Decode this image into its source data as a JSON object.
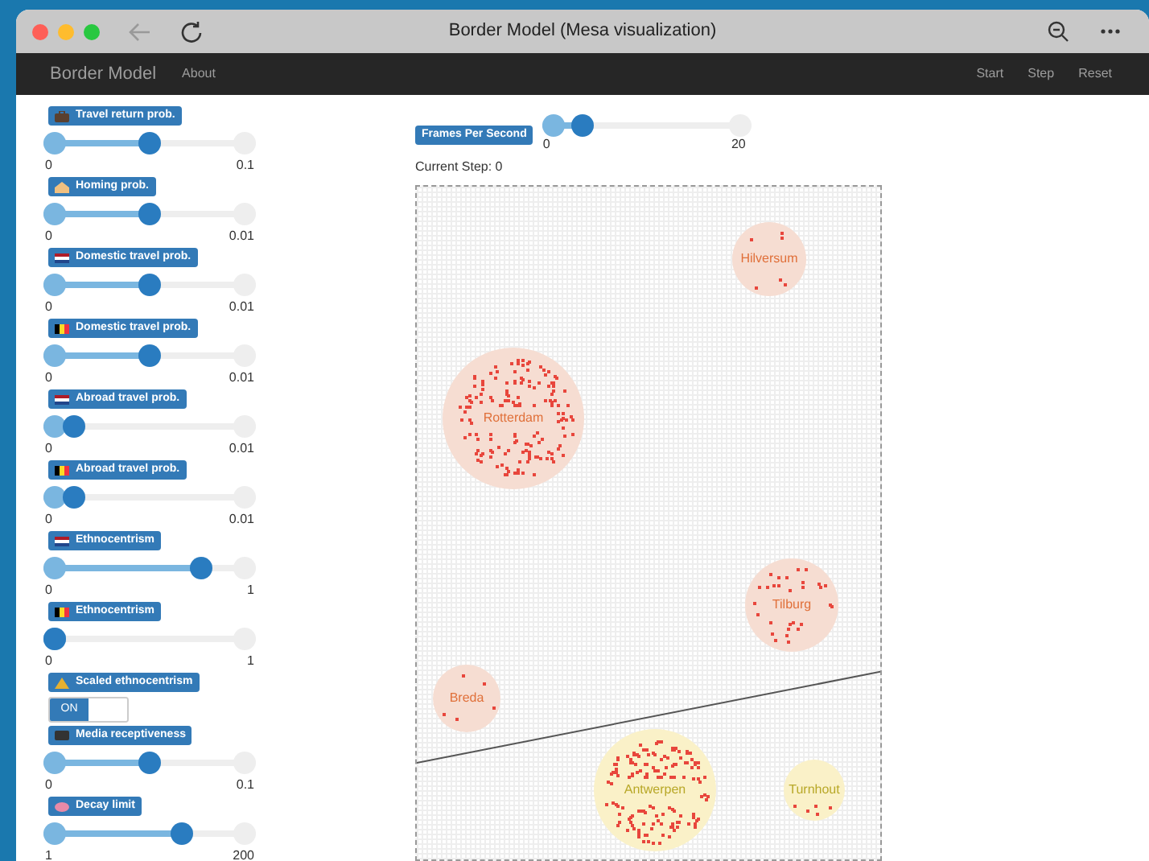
{
  "window": {
    "title": "Border Model (Mesa visualization)"
  },
  "navbar": {
    "brand": "Border Model",
    "links": [
      "About"
    ],
    "actions": [
      "Start",
      "Step",
      "Reset"
    ]
  },
  "params": [
    {
      "kind": "slider",
      "label": "Travel return prob.",
      "level": 0.5,
      "min": "0",
      "max": "0.1"
    },
    {
      "kind": "slider",
      "label": "Homing prob.",
      "level": 0.5,
      "min": "0",
      "max": "0.01"
    },
    {
      "kind": "slider",
      "label": "Domestic travel prob.",
      "level": 0.5,
      "min": "0",
      "max": "0.01"
    },
    {
      "kind": "slider",
      "label": "Domestic travel prob.",
      "level": 0.5,
      "min": "0",
      "max": "0.01"
    },
    {
      "kind": "slider",
      "label": "Abroad travel prob.",
      "level": 0.1,
      "min": "0",
      "max": "0.01"
    },
    {
      "kind": "slider",
      "label": "Abroad travel prob.",
      "level": 0.1,
      "min": "0",
      "max": "0.01"
    },
    {
      "kind": "slider",
      "label": "Ethnocentrism",
      "level": 0.77,
      "min": "0",
      "max": "1"
    },
    {
      "kind": "slider",
      "label": "Ethnocentrism",
      "level": 0,
      "min": "0",
      "max": "1"
    },
    {
      "kind": "switch",
      "label": "Scaled ethnocentrism",
      "on": true,
      "state_text": "ON"
    },
    {
      "kind": "slider",
      "label": "Media receptiveness",
      "level": 0.5,
      "min": "0",
      "max": "0.1"
    },
    {
      "kind": "slider",
      "label": "Decay limit",
      "level": 0.67,
      "min": "1",
      "max": "200"
    }
  ],
  "fps": {
    "label": "Frames Per Second",
    "level": 0.15,
    "min": "0",
    "max": "20"
  },
  "step": "Current Step: 0",
  "cities": [
    {
      "name": "Hilversum",
      "color": "#f6ddd2"
    },
    {
      "name": "Rotterdam",
      "color": "#f6ddd2"
    },
    {
      "name": "Tilburg",
      "color": "#f6ddd2"
    },
    {
      "name": "Breda",
      "color": "#f6ddd2"
    },
    {
      "name": "Antwerpen",
      "color": "#faf1c8"
    },
    {
      "name": "Turnhout",
      "color": "#faf1c8"
    }
  ]
}
